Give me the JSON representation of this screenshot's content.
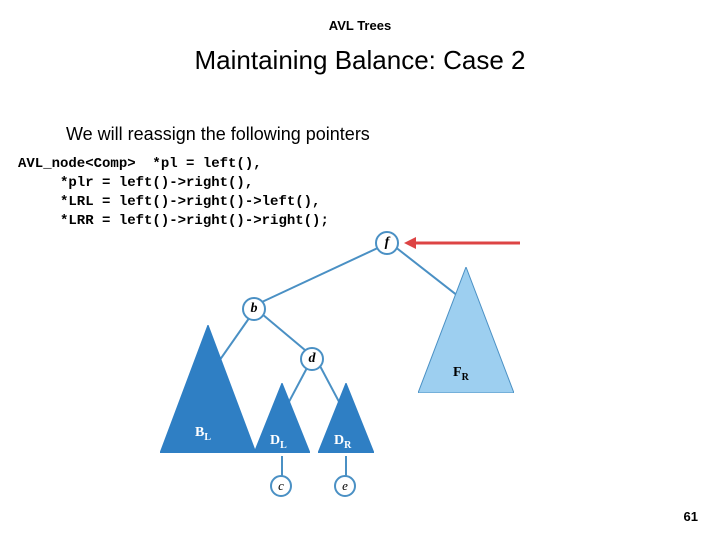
{
  "header": "AVL Trees",
  "title": "Maintaining Balance: Case 2",
  "intro": "We will reassign the following pointers",
  "code": {
    "l1": "AVL_node<Comp>  *pl = left(),",
    "l2": "     *plr = left()->right(),",
    "l3": "     *LRL = left()->right()->left(),",
    "l4": "     *LRR = left()->right()->right();"
  },
  "nodes": {
    "f": "f",
    "b": "b",
    "d": "d",
    "c": "c",
    "e": "e"
  },
  "subtrees": {
    "BL": "B",
    "BLsub": "L",
    "DL": "D",
    "DLsub": "L",
    "DR": "D",
    "DRsub": "R",
    "FR": "F",
    "FRsub": "R"
  },
  "pagenum": "61"
}
